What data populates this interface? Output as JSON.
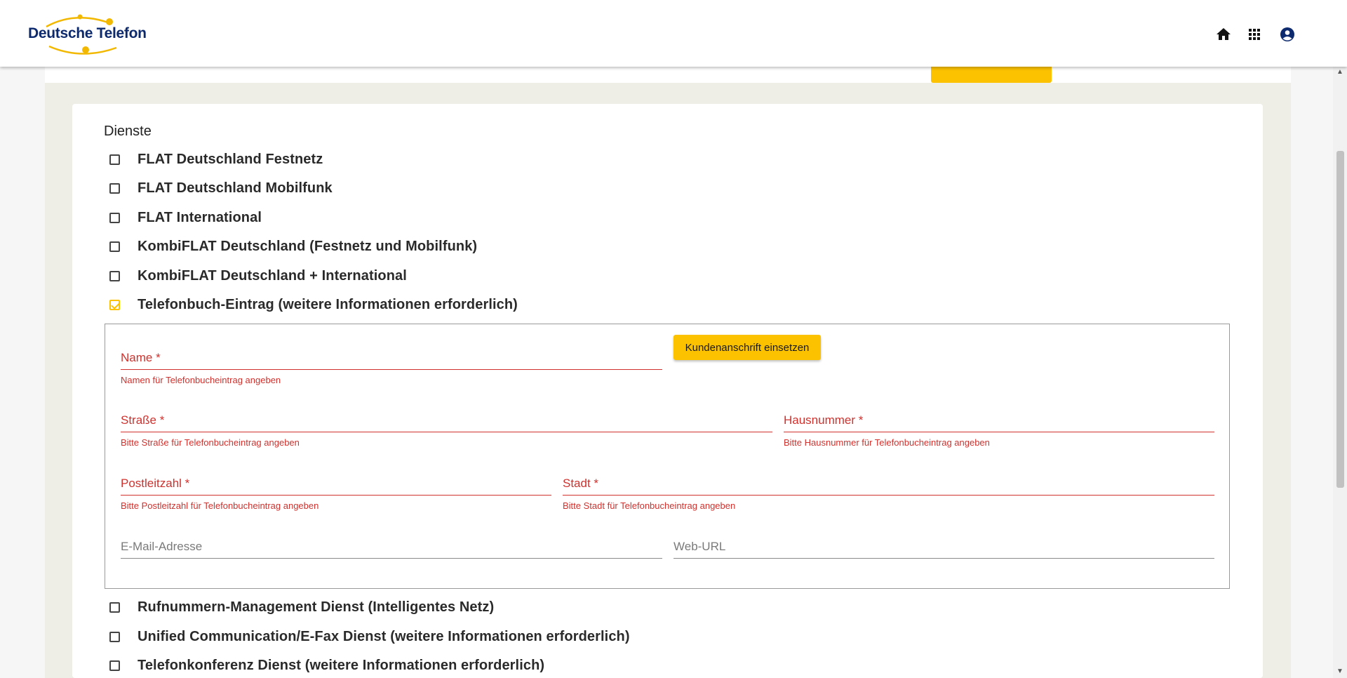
{
  "header": {
    "logo_text": "Deutsche Telefon",
    "icons": [
      "home-icon",
      "apps-grid-icon",
      "account-circle-icon"
    ]
  },
  "section": {
    "title": "Dienste"
  },
  "services": [
    {
      "label": "FLAT Deutschland Festnetz",
      "checked": false
    },
    {
      "label": "FLAT Deutschland Mobilfunk",
      "checked": false
    },
    {
      "label": "FLAT International",
      "checked": false
    },
    {
      "label": "KombiFLAT Deutschland (Festnetz und Mobilfunk)",
      "checked": false
    },
    {
      "label": "KombiFLAT Deutschland + International",
      "checked": false
    },
    {
      "label": "Telefonbuch-Eintrag (weitere Informationen erforderlich)",
      "checked": true
    },
    {
      "label": "Rufnummern-Management Dienst (Intelligentes Netz)",
      "checked": false
    },
    {
      "label": "Unified Communication/E-Fax Dienst (weitere Informationen erforderlich)",
      "checked": false
    },
    {
      "label": "Telefonkonferenz Dienst (weitere Informationen erforderlich)",
      "checked": false
    }
  ],
  "phonebook_form": {
    "button_label": "Kundenanschrift einsetzen",
    "name": {
      "label": "Name *",
      "hint": "Namen für Telefonbucheintrag angeben",
      "value": ""
    },
    "street": {
      "label": "Straße *",
      "hint": "Bitte Straße für Telefonbucheintrag angeben",
      "value": ""
    },
    "house_number": {
      "label": "Hausnummer *",
      "hint": "Bitte Hausnummer für Telefonbucheintrag angeben",
      "value": ""
    },
    "postal_code": {
      "label": "Postleitzahl *",
      "hint": "Bitte Postleitzahl für Telefonbucheintrag angeben",
      "value": ""
    },
    "city": {
      "label": "Stadt *",
      "hint": "Bitte Stadt für Telefonbucheintrag angeben",
      "value": ""
    },
    "email": {
      "label": "E-Mail-Adresse",
      "value": ""
    },
    "web_url": {
      "label": "Web-URL",
      "value": ""
    }
  },
  "colors": {
    "accent": "#fcc200",
    "error": "#d0312d",
    "brand_navy": "#0d2a6e"
  }
}
